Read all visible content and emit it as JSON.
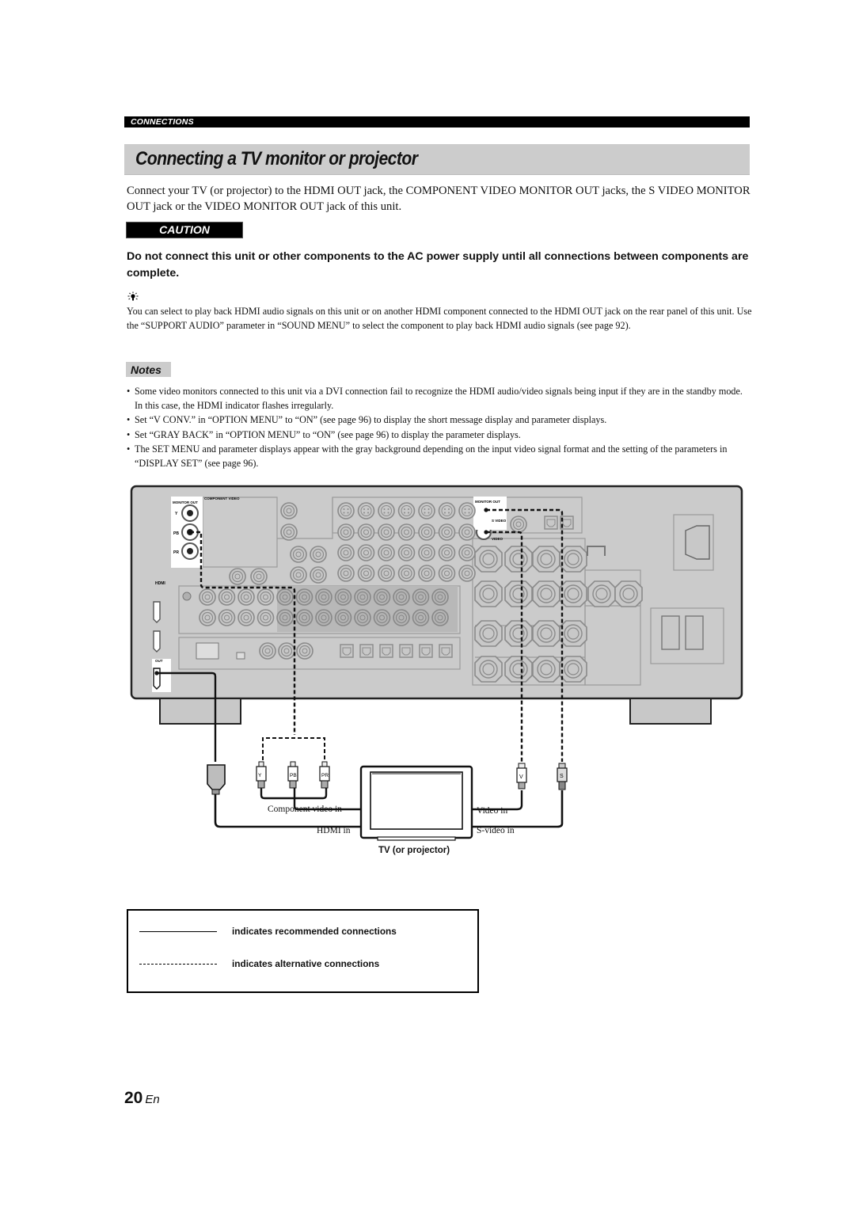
{
  "header": {
    "section": "CONNECTIONS",
    "title": "Connecting a TV monitor or projector"
  },
  "intro": "Connect your TV (or projector) to the HDMI OUT jack, the COMPONENT VIDEO MONITOR OUT jacks, the S VIDEO MONITOR OUT jack or the VIDEO MONITOR OUT jack of this unit.",
  "caution": {
    "label": "CAUTION",
    "text": "Do not connect this unit or other components to the AC power supply until all connections between components are complete."
  },
  "tip": {
    "icon": "lightbulb-icon",
    "text": "You can select to play back HDMI audio signals on this unit or on another HDMI component connected to the HDMI OUT jack on the rear panel of this unit. Use the “SUPPORT AUDIO” parameter in “SOUND MENU” to select the component to play back HDMI audio signals (see page 92)."
  },
  "notes": {
    "label": "Notes",
    "items": [
      "Some video monitors connected to this unit via a DVI connection fail to recognize the HDMI audio/video signals being input if they are in the standby mode. In this case, the HDMI indicator flashes irregularly.",
      "Set “V CONV.” in “OPTION MENU” to “ON” (see page 96) to display the short message display and parameter displays.",
      "Set “GRAY BACK” in “OPTION MENU” to “ON” (see page 96) to display the parameter displays.",
      "The SET MENU and parameter displays appear with the gray background depending on the input video signal format and the setting of the parameters in “DISPLAY SET” (see page 96)."
    ]
  },
  "diagram": {
    "panel_labels": {
      "monitor_out_left": "MONITOR OUT",
      "component_video": "COMPONENT VIDEO",
      "y": "Y",
      "pb": "PB",
      "pr": "PR",
      "hdmi": "HDMI",
      "out": "OUT",
      "monitor_out_right": "MONITOR OUT",
      "s_video": "S VIDEO",
      "video": "VIDEO"
    },
    "plugs": {
      "y": "Y",
      "pb": "PB",
      "pr": "PR",
      "v": "V",
      "s": "S"
    },
    "tv_inputs": {
      "component": "Component video in",
      "hdmi": "HDMI in",
      "video": "Video in",
      "svideo": "S-video in"
    },
    "tv_caption": "TV (or projector)"
  },
  "legend": {
    "recommended": "indicates recommended connections",
    "alternative": "indicates alternative connections"
  },
  "footer": {
    "page": "20",
    "lang": "En"
  }
}
